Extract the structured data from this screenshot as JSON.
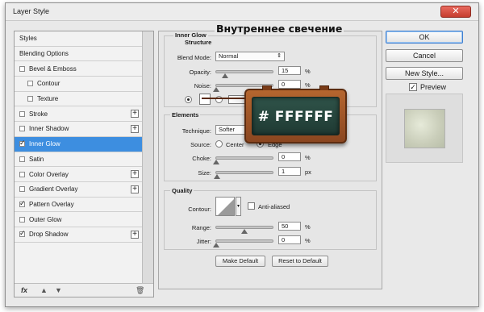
{
  "window": {
    "title": "Layer Style",
    "close_glyph": "✕"
  },
  "styles_list": [
    {
      "label": "Styles",
      "checkbox": false,
      "checked": false,
      "add": false,
      "indent": 0
    },
    {
      "label": "Blending Options",
      "checkbox": false,
      "checked": false,
      "add": false,
      "indent": 0
    },
    {
      "label": "Bevel & Emboss",
      "checkbox": true,
      "checked": false,
      "add": false,
      "indent": 0
    },
    {
      "label": "Contour",
      "checkbox": true,
      "checked": false,
      "add": false,
      "indent": 1
    },
    {
      "label": "Texture",
      "checkbox": true,
      "checked": false,
      "add": false,
      "indent": 1
    },
    {
      "label": "Stroke",
      "checkbox": true,
      "checked": false,
      "add": true,
      "indent": 0
    },
    {
      "label": "Inner Shadow",
      "checkbox": true,
      "checked": false,
      "add": true,
      "indent": 0
    },
    {
      "label": "Inner Glow",
      "checkbox": true,
      "checked": true,
      "add": false,
      "indent": 0,
      "active": true
    },
    {
      "label": "Satin",
      "checkbox": true,
      "checked": false,
      "add": false,
      "indent": 0
    },
    {
      "label": "Color Overlay",
      "checkbox": true,
      "checked": false,
      "add": true,
      "indent": 0
    },
    {
      "label": "Gradient Overlay",
      "checkbox": true,
      "checked": false,
      "add": true,
      "indent": 0
    },
    {
      "label": "Pattern Overlay",
      "checkbox": true,
      "checked": true,
      "add": false,
      "indent": 0
    },
    {
      "label": "Outer Glow",
      "checkbox": true,
      "checked": false,
      "add": false,
      "indent": 0
    },
    {
      "label": "Drop Shadow",
      "checkbox": true,
      "checked": true,
      "add": true,
      "indent": 0
    }
  ],
  "footer": {
    "fx": "fx",
    "up": "▲",
    "down": "▼",
    "trash": "🗑"
  },
  "inner_glow": {
    "section_title": "Inner Glow",
    "structure_title": "Structure",
    "blend_mode_label": "Blend Mode:",
    "blend_mode_value": "Normal",
    "opacity_label": "Opacity:",
    "opacity_value": "15",
    "opacity_level": 0.15,
    "noise_label": "Noise:",
    "noise_value": "0",
    "noise_level": 0,
    "percent": "%",
    "glow_color": "#FFFFFF"
  },
  "elements": {
    "title": "Elements",
    "technique_label": "Technique:",
    "technique_value": "Softer",
    "source_label": "Source:",
    "source_center": "Center",
    "source_edge": "Edge",
    "choke_label": "Choke:",
    "choke_value": "0",
    "choke_level": 0,
    "size_label": "Size:",
    "size_value": "1",
    "size_level": 0.01,
    "px": "px"
  },
  "quality": {
    "title": "Quality",
    "contour_label": "Contour:",
    "anti_aliased_label": "Anti-aliased",
    "anti_aliased_checked": false,
    "range_label": "Range:",
    "range_value": "50",
    "range_level": 0.5,
    "jitter_label": "Jitter:",
    "jitter_value": "0",
    "jitter_level": 0
  },
  "actions": {
    "make_default": "Make Default",
    "reset_default": "Reset to Default"
  },
  "right": {
    "ok": "OK",
    "cancel": "Cancel",
    "new_style": "New Style...",
    "preview_label": "Preview",
    "preview_checked": true
  },
  "overlay": {
    "caption": "Внутреннее свечение",
    "color_code": "# FFFFFF"
  }
}
